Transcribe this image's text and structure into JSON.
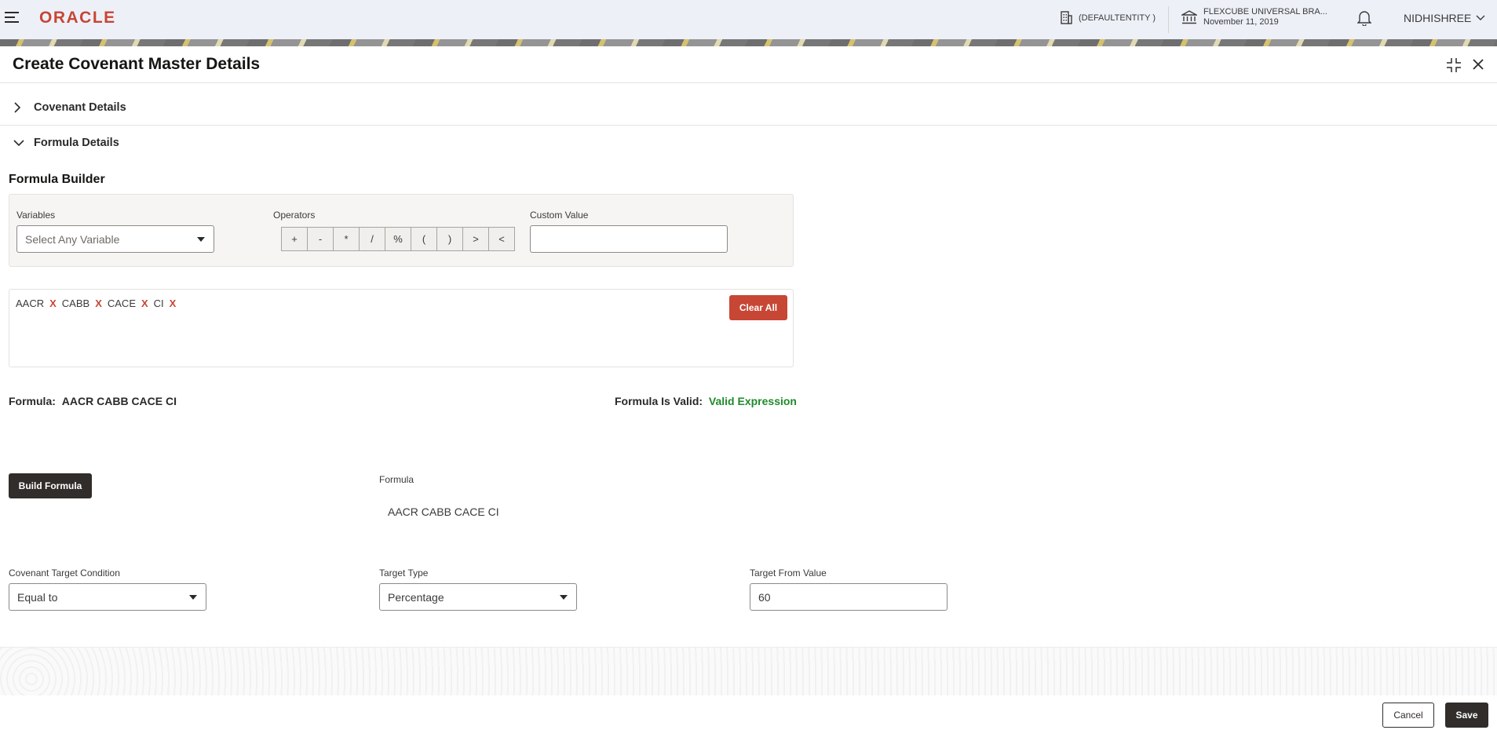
{
  "header": {
    "logo_text": "ORACLE",
    "entity": "(DEFAULTENTITY )",
    "branch_name": "FLEXCUBE UNIVERSAL BRA...",
    "branch_date": "November 11, 2019",
    "user": "NIDHISHREE"
  },
  "page": {
    "title": "Create Covenant Master Details"
  },
  "sections": {
    "covenant_details": "Covenant Details",
    "formula_details": "Formula Details"
  },
  "formula_builder": {
    "title": "Formula Builder",
    "variables_label": "Variables",
    "variables_placeholder": "Select Any Variable",
    "operators_label": "Operators",
    "operators": [
      "+",
      "-",
      "*",
      "/",
      "%",
      "(",
      ")",
      ">",
      "<"
    ],
    "custom_value_label": "Custom Value",
    "custom_value": "",
    "tokens": [
      "AACR",
      "CABB",
      "CACE",
      "CI"
    ],
    "token_remove": "X",
    "clear_all": "Clear All",
    "formula_label": "Formula:",
    "formula_text": "AACR CABB CACE CI",
    "valid_label": "Formula Is Valid:",
    "valid_value": "Valid Expression",
    "build_button": "Build Formula",
    "formula_field_label": "Formula",
    "formula_field_value": "AACR CABB CACE CI"
  },
  "target": {
    "condition_label": "Covenant Target Condition",
    "condition_value": "Equal to",
    "type_label": "Target Type",
    "type_value": "Percentage",
    "from_label": "Target From Value",
    "from_value": "60"
  },
  "footer": {
    "cancel": "Cancel",
    "save": "Save"
  },
  "colors": {
    "brand_red": "#c74634",
    "valid_green": "#1f8a2b",
    "dark_button": "#312d2a"
  }
}
